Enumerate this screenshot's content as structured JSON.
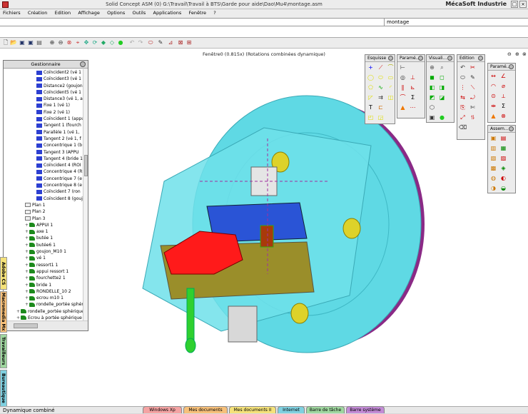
{
  "window": {
    "title": "Solid Concept ASM (0) G:\\Travail\\Travail à BTS\\Garde pour aide\\Dao\\Mu4\\montage.asm",
    "brand": "MécaSoft Industrie",
    "min": "_",
    "max": "□",
    "close": "×"
  },
  "menu": [
    "Fichiers",
    "Création",
    "Edition",
    "Affichage",
    "Options",
    "Outils",
    "Applications",
    "Fenêtre",
    "?"
  ],
  "command_line": {
    "value": "montage"
  },
  "viewport": {
    "title": "Fenêtre0 (0.815x) (Rotations combinées dynamique)"
  },
  "manager": {
    "title": "Gestionnaire",
    "items": [
      {
        "label": "Coïncident2 (vé 1",
        "type": "constr",
        "depth": 2
      },
      {
        "label": "Coïncident3 (vé 1",
        "type": "constr",
        "depth": 2
      },
      {
        "label": "Distance2 (goujon",
        "type": "constr",
        "depth": 2
      },
      {
        "label": "Coïncident5 (vé 1",
        "type": "constr",
        "depth": 2
      },
      {
        "label": "Distance3 (vé 1, a",
        "type": "constr",
        "depth": 2
      },
      {
        "label": "Fixe 1 (vé 1)",
        "type": "constr",
        "depth": 2
      },
      {
        "label": "Fixe 2 (vé 1)",
        "type": "constr",
        "depth": 2
      },
      {
        "label": "Coïncident 1 (appu",
        "type": "constr",
        "depth": 2
      },
      {
        "label": "Tangent 1 (fourch",
        "type": "constr",
        "depth": 2
      },
      {
        "label": "Parallèle 1 (vé 1,",
        "type": "constr",
        "depth": 2
      },
      {
        "label": "Tangent 2 (vé 1, f",
        "type": "constr",
        "depth": 2
      },
      {
        "label": "Concentrique 1 (b",
        "type": "constr",
        "depth": 2
      },
      {
        "label": "Tangent 3 (APPU",
        "type": "constr",
        "depth": 2
      },
      {
        "label": "Tangent 4 (bride 1",
        "type": "constr",
        "depth": 2
      },
      {
        "label": "Coïncident 4 (ROI",
        "type": "constr",
        "depth": 2
      },
      {
        "label": "Concentrique 4 (R",
        "type": "constr",
        "depth": 2
      },
      {
        "label": "Concentrique 7 (e",
        "type": "constr",
        "depth": 2
      },
      {
        "label": "Concentrique 8 (e",
        "type": "constr",
        "depth": 2
      },
      {
        "label": "Coïncident 7 (ron",
        "type": "constr",
        "depth": 2
      },
      {
        "label": "Coïncident 8 (gouj",
        "type": "constr",
        "depth": 2
      },
      {
        "label": "Plan 1",
        "type": "plane",
        "depth": 1
      },
      {
        "label": "Plan 2",
        "type": "plane",
        "depth": 1
      },
      {
        "label": "Plan 3",
        "type": "plane",
        "depth": 1
      },
      {
        "label": "APPUI 1",
        "type": "part",
        "depth": 1
      },
      {
        "label": "axe 1",
        "type": "part",
        "depth": 1
      },
      {
        "label": "butée 1",
        "type": "part",
        "depth": 1
      },
      {
        "label": "butée6 1",
        "type": "part",
        "depth": 1
      },
      {
        "label": "goujon_M10 1",
        "type": "part",
        "depth": 1
      },
      {
        "label": "vé 1",
        "type": "part",
        "depth": 1
      },
      {
        "label": "ressort1 1",
        "type": "part",
        "depth": 1
      },
      {
        "label": "appui ressort 1",
        "type": "part",
        "depth": 1
      },
      {
        "label": "fourchette2 1",
        "type": "part",
        "depth": 1
      },
      {
        "label": "bride 1",
        "type": "part",
        "depth": 1
      },
      {
        "label": "RONDELLE_10 2",
        "type": "part",
        "depth": 1
      },
      {
        "label": "ecrou m10 1",
        "type": "part",
        "depth": 1
      },
      {
        "label": "rondelle_portée sphériq",
        "type": "part",
        "depth": 1
      },
      {
        "label": "rondelle_portée sphérique",
        "type": "part",
        "depth": 0
      },
      {
        "label": "Ecrou à portée sphérique 1",
        "type": "part",
        "depth": 0
      }
    ]
  },
  "side_tabs": [
    "Adobe CS",
    "Macromedia Mx",
    "Travailleurs",
    "Bureautique"
  ],
  "palettes": {
    "esquisse": "Esquisse",
    "parametrage1": "Paramé...",
    "visualisation": "Visuali...",
    "edition": "Edition",
    "parametrage2": "Paramé...",
    "assemblage": "Assem..."
  },
  "status": {
    "text": "Dynamique combiné"
  },
  "taskbar_tabs": [
    {
      "label": "Windows Xp",
      "color": "#f4a3a3"
    },
    {
      "label": "Mes documents",
      "color": "#f7c07a"
    },
    {
      "label": "Mes documents II",
      "color": "#f5e27a"
    },
    {
      "label": "Internet",
      "color": "#7fd0e0"
    },
    {
      "label": "Barre de tâche",
      "color": "#9fd79f"
    },
    {
      "label": "Barre système",
      "color": "#c38bd6"
    }
  ],
  "colors": {
    "body_cyan": "#59d9e3",
    "disk_purple": "#8a2a86",
    "clamp_red": "#ff1a1a",
    "block_blue": "#2a54d6",
    "base_olive": "#9a8e2a",
    "knob_yellow": "#ddd22a",
    "handle_green": "#2fd02f"
  }
}
